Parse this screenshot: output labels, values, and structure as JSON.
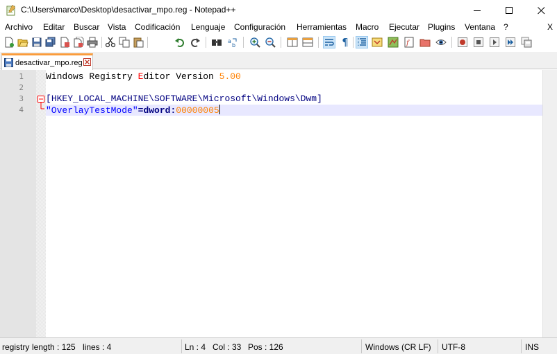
{
  "window": {
    "title": "C:\\Users\\marco\\Desktop\\desactivar_mpo.reg - Notepad++",
    "minimize_glyph": "—",
    "maximize_glyph": "☐",
    "close_glyph": "✕"
  },
  "menu": {
    "items": [
      "Archivo",
      "Editar",
      "Buscar",
      "Vista",
      "Codificación",
      "Lenguaje",
      "Configuración",
      "Herramientas",
      "Macro",
      "Ejecutar",
      "Plugins",
      "Ventana",
      "?"
    ],
    "close_doc": "X"
  },
  "toolbar": {
    "icons": [
      "new-file-icon",
      "open-file-icon",
      "save-icon",
      "save-all-icon",
      "close-icon",
      "close-all-icon",
      "print-icon",
      "cut-icon",
      "copy-icon",
      "paste-icon",
      "undo-icon",
      "redo-icon",
      "find-icon",
      "replace-icon",
      "zoom-in-icon",
      "zoom-out-icon",
      "sync-vertical-icon",
      "sync-horizontal-icon",
      "word-wrap-icon",
      "show-all-chars-icon",
      "indent-guide-icon",
      "language-icon",
      "doc-map-icon",
      "function-list-icon",
      "folder-workspace-icon",
      "monitoring-icon",
      "record-macro-icon",
      "stop-macro-icon",
      "play-macro-icon",
      "run-macro-multiple-icon",
      "save-macro-icon"
    ]
  },
  "tab": {
    "label": "desactivar_mpo.reg"
  },
  "editor": {
    "line_numbers": [
      "1",
      "2",
      "3",
      "4"
    ],
    "line1": {
      "p1": "Windows Registry ",
      "p2": "E",
      "p3": "ditor Version ",
      "p4": "5.00"
    },
    "line3": {
      "bracket_open": "[",
      "key": "HKEY_LOCAL_MACHINE\\SOFTWARE\\Microsoft\\Windows\\Dwm",
      "bracket_close": "]"
    },
    "line4": {
      "name": "\"OverlayTestMode\"",
      "eq": "=",
      "type": "dword",
      "colon": ":",
      "value": "00000005"
    }
  },
  "status": {
    "lang": "registry",
    "length": "length : 125",
    "lines": "lines : 4",
    "ln": "Ln : 4",
    "col": "Col : 33",
    "pos": "Pos : 126",
    "eol": "Windows (CR LF)",
    "encoding": "UTF-8",
    "mode": "INS"
  },
  "colors": {
    "tab_accent": "#fa9c3c",
    "current_line": "#e8e8ff",
    "fold_marker": "#ff0000"
  }
}
